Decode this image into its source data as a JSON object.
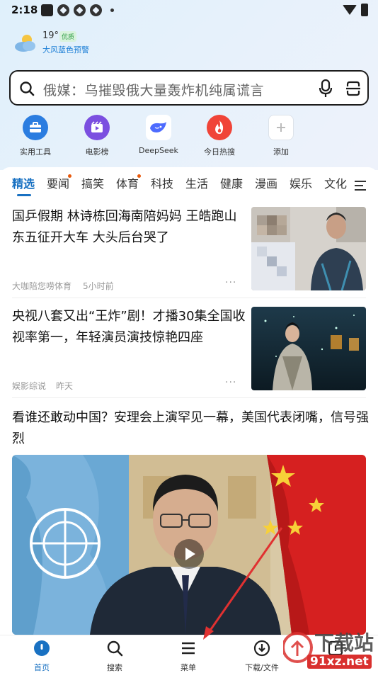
{
  "status_bar": {
    "time": "2:18"
  },
  "weather": {
    "temperature": "19°",
    "aqi_badge": "优质",
    "alert": "大风蓝色预警"
  },
  "search": {
    "placeholder": "俄媒：乌摧毁俄大量轰炸机纯属谎言"
  },
  "shortcuts": [
    {
      "label": "实用工具",
      "icon": "toolbox-icon"
    },
    {
      "label": "电影榜",
      "icon": "film-icon"
    },
    {
      "label": "DeepSeek",
      "icon": "deepseek-whale-icon"
    },
    {
      "label": "今日热搜",
      "icon": "flame-icon"
    },
    {
      "label": "添加",
      "icon": "plus-icon"
    }
  ],
  "tabs": [
    {
      "label": "精选",
      "active": true
    },
    {
      "label": "要闻",
      "dot": true
    },
    {
      "label": "搞笑"
    },
    {
      "label": "体育",
      "dot": true
    },
    {
      "label": "科技"
    },
    {
      "label": "生活"
    },
    {
      "label": "健康"
    },
    {
      "label": "漫画"
    },
    {
      "label": "娱乐"
    },
    {
      "label": "文化"
    }
  ],
  "news": [
    {
      "title": "国乒假期 林诗栋回海南陪妈妈 王皓跑山东五征开大车 大头后台哭了",
      "source": "大咖陪您唠体育",
      "time": "5小时前",
      "more": "···"
    },
    {
      "title": "央视八套又出“王炸”剧！才播30集全国收视率第一，年轻演员演技惊艳四座",
      "source": "娱影综说",
      "time": "昨天",
      "more": "···"
    },
    {
      "title": "看谁还敢动中国？安理会上演罕见一幕，美国代表闭嘴，信号强烈"
    }
  ],
  "bottom_nav": [
    {
      "label": "首页",
      "active": true
    },
    {
      "label": "搜索"
    },
    {
      "label": "菜单"
    },
    {
      "label": "下载/文件"
    },
    {
      "label": ""
    }
  ],
  "watermark": {
    "text": "下载站",
    "domain": "91xz.net"
  },
  "colors": {
    "accent": "#1971c2",
    "notify_dot": "#e8590c",
    "arrow": "#e03131"
  }
}
